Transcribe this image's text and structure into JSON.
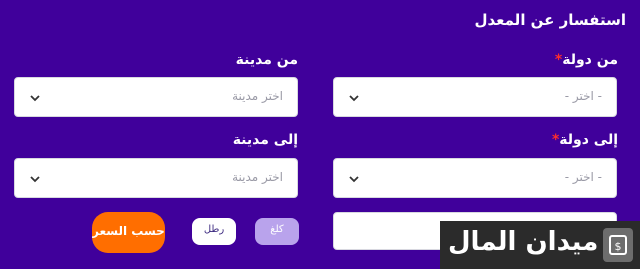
{
  "form": {
    "title": "استفسار عن المعدل",
    "from_country": {
      "label": "من دولة",
      "placeholder": "- اختر -"
    },
    "from_city": {
      "label": "من مدينة",
      "placeholder": "اختر مدينة"
    },
    "to_country": {
      "label": "إلى دولة",
      "placeholder": "- اختر -"
    },
    "to_city": {
      "label": "إلى مدينة",
      "placeholder": "اختر مدينة"
    },
    "required_mark": "*",
    "weight_input": {
      "value": ""
    },
    "units": {
      "kg": "كلغ",
      "rtl": "رطل"
    },
    "calculate_label": "احسب السعر"
  },
  "watermark": {
    "text": "ميدان المال"
  },
  "colors": {
    "background": "#40009b",
    "accent": "#ff6e00",
    "required": "#ff2d2d"
  }
}
